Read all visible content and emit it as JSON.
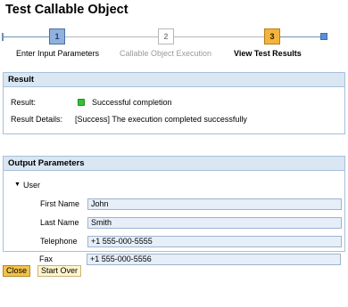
{
  "page": {
    "title": "Test Callable Object"
  },
  "roadmap": {
    "steps": [
      {
        "number": "1",
        "label": "Enter Input Parameters",
        "state": "completed"
      },
      {
        "number": "2",
        "label": "Callable Object Execution",
        "state": "inactive"
      },
      {
        "number": "3",
        "label": "View Test Results",
        "state": "current"
      }
    ]
  },
  "result_panel": {
    "header": "Result",
    "result_label": "Result:",
    "result_value": "Successful completion",
    "status_color": "#33c233",
    "details_label": "Result Details:",
    "details_value": "[Success] The execution completed successfully"
  },
  "output_panel": {
    "header": "Output Parameters",
    "tree_node": "User",
    "fields": [
      {
        "label": "First Name",
        "value": "John"
      },
      {
        "label": "Last Name",
        "value": "Smith"
      },
      {
        "label": "Telephone",
        "value": "+1 555-000-5555"
      },
      {
        "label": "Fax",
        "value": "+1 555-000-5556"
      }
    ]
  },
  "buttons": {
    "close": "Close",
    "start_over": "Start Over"
  },
  "colors": {
    "accent_orange": "#f3b43c",
    "step_blue": "#8fb1de",
    "panel_header": "#dae6f2",
    "input_bg": "#e6eef8"
  }
}
